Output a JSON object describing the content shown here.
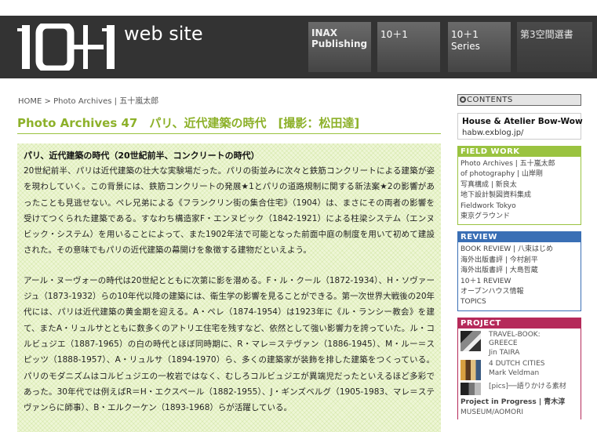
{
  "header": {
    "logo_text": "web site",
    "nav": [
      {
        "label": "INAX\nPublishing"
      },
      {
        "label": "10＋1"
      },
      {
        "label": "10＋1 Series"
      },
      {
        "label": "第3空間選書"
      }
    ]
  },
  "breadcrumb": {
    "home": "HOME",
    "sep": ">",
    "section": "Photo Archives",
    "pipe": "|",
    "author": "五十嵐太郎"
  },
  "page_title": "Photo Archives 47　パリ、近代建築の時代　[撮影：松田達]",
  "article": {
    "heading": "パリ、近代建築の時代（20世紀前半、コンクリートの時代）",
    "paragraphs": [
      "20世紀前半、パリは近代建築の壮大な実験場だった。パリの街並みに次々と鉄筋コンクリートによる建築が姿を現わしていく。この背景には、鉄筋コンクリートの発展★1とパリの道路規制に関する新法案★2の影響があったことも見逃せない。ペレ兄弟による《フランクリン街の集合住宅》（1904）は、まさにその両者の影響を受けてつくられた建築である。すなわち構造家F・エンヌビック（1842-1921）による柱梁システム（エンヌビック・システム）を用いることによって、また1902年法で可能となった前面中庭の制度を用いて初めて建設された。その意味でもパリの近代建築の幕開けを象徴する建物だといえよう。",
      "アール・ヌーヴォーの時代は20世紀とともに次第に影を潜める。F・ル・クール（1872-1934）、H・ソヴァージュ（1873-1932）らの10年代以降の建築には、衛生学の影響を見ることができる。第一次世界大戦後の20年代には、パリは近代建築の黄金期を迎える。A・ペレ（1874-1954）は1923年に《ル・ランシー教会》を建て、またA・リュルサとともに数多くのアトリエ住宅を残すなど、依然として強い影響力を誇っていた。ル・コルビュジエ（1887-1965）の白の時代とほぼ同時期に、R・マレ＝ステヴァン（1886-1945）、M・ルー＝スピッツ（1888-1957）、A・リュルサ（1894-1970）ら、多くの建築家が装飾を排した建築をつくっている。パリのモダニズムはコルビュジエの一枚岩ではなく、むしろコルビュジエが異端児だったといえるほど多彩であった。30年代では例えばR＝H・エクスペール（1882-1955）、J・ギンズベルグ（1905-1983、マレ＝ステヴァンらに師事）、B・エルクーケン（1893-1968）らが活躍している。"
    ]
  },
  "sidebar": {
    "contents_label": "CONTENTS",
    "bow": {
      "title": "House & Atelier Bow-Wow",
      "link": "habw.exblog.jp/"
    },
    "field_work": {
      "head": "FIELD WORK",
      "items": [
        "Photo Archives | 五十嵐太郎",
        "of photography | 山岸剛",
        "写真構成 | 新良太",
        "地下設計製図資料集成",
        "Fieldwork Tokyo",
        "東京グラウンド"
      ]
    },
    "review": {
      "head": "REVIEW",
      "items": [
        "BOOK REVIEW | 八束はじめ",
        "海外出版書評 | 今村創平",
        "海外出版書評 | 大島哲蔵",
        "10＋1 REVIEW",
        "オープンハウス情報",
        "TOPICS"
      ]
    },
    "project": {
      "head": "PROJECT",
      "items": [
        {
          "lines": [
            "TRAVEL-BOOK:",
            "GREECE",
            "Jin TAIRA"
          ]
        },
        {
          "lines": [
            "4 DUTCH CITIES",
            "Mark Veldman"
          ]
        },
        {
          "lines": [
            "[pics]──語りかける素材"
          ]
        }
      ],
      "progress_label": "Project in Progress | 青木淳",
      "progress_sub": "MUSEUM/AOMORI"
    }
  },
  "colors": {
    "header_bg": "#333333",
    "accent_green": "#8db12a",
    "review_blue": "#3a6fb5",
    "project_red": "#b52a5a"
  }
}
